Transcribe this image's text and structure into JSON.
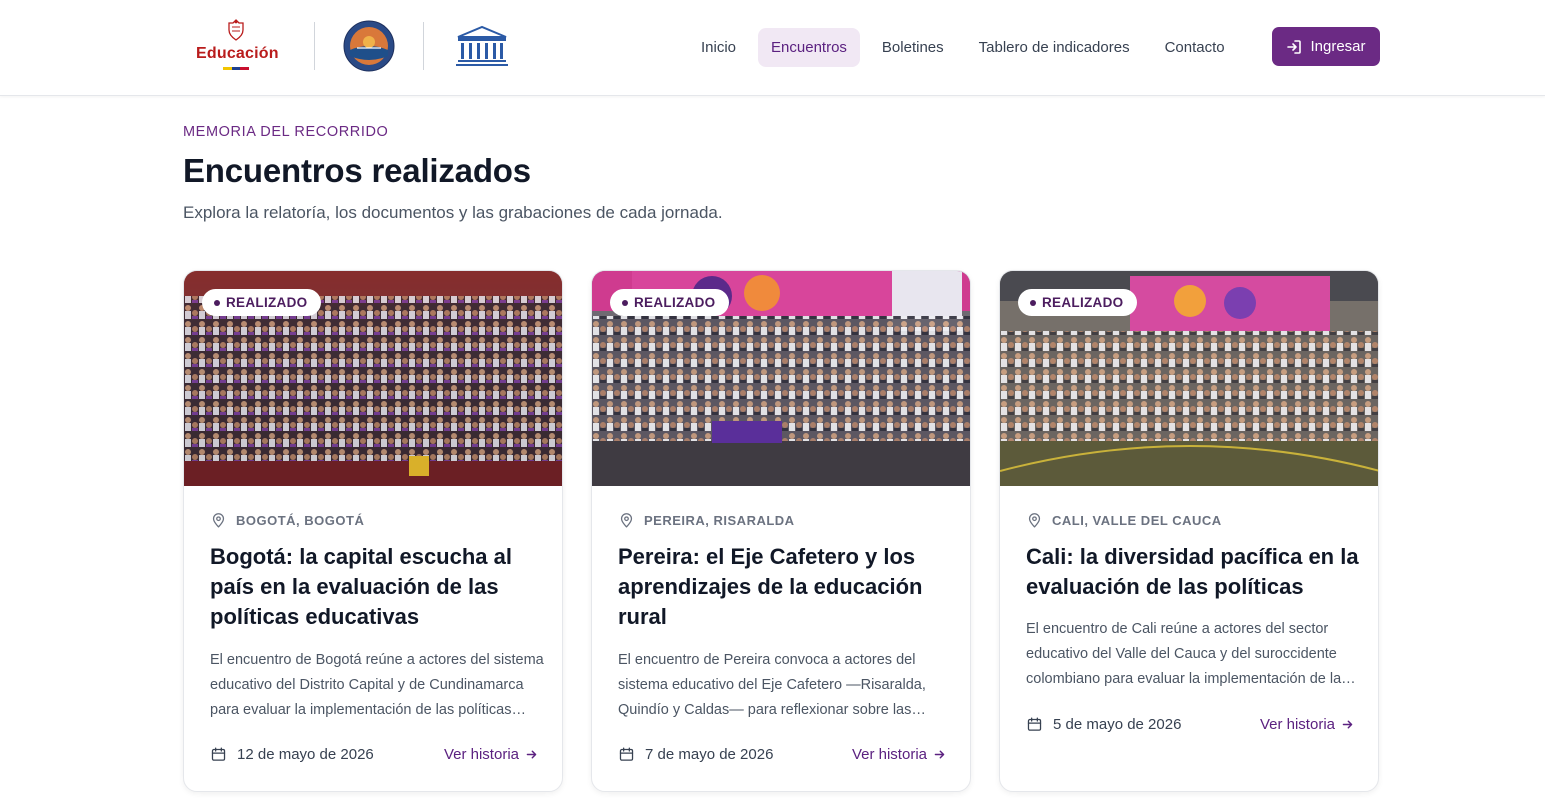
{
  "header": {
    "logo_education_text": "Educación",
    "nav": [
      {
        "label": "Inicio",
        "active": false
      },
      {
        "label": "Encuentros",
        "active": true
      },
      {
        "label": "Boletines",
        "active": false
      },
      {
        "label": "Tablero de indicadores",
        "active": false
      },
      {
        "label": "Contacto",
        "active": false
      }
    ],
    "login_label": "Ingresar"
  },
  "section": {
    "eyebrow": "MEMORIA DEL RECORRIDO",
    "title": "Encuentros realizados",
    "subtitle": "Explora la relatoría, los documentos y las grabaciones de cada jornada."
  },
  "cards": [
    {
      "badge": "REALIZADO",
      "location": "BOGOTÁ, BOGOTÁ",
      "title": "Bogotá: la capital escucha al país en la evaluación de las políticas educativas",
      "description": "El encuentro de Bogotá reúne a actores del sistema educativo del Distrito Capital y de Cundinamarca para evaluar la implementación de las políticas educativas.",
      "date": "12 de mayo de 2026",
      "link": "Ver historia"
    },
    {
      "badge": "REALIZADO",
      "location": "PEREIRA, RISARALDA",
      "title": "Pereira: el Eje Cafetero y los aprendizajes de la educación rural",
      "description": "El encuentro de Pereira convoca a actores del sistema educativo del Eje Cafetero —Risaralda, Quindío y Caldas— para reflexionar sobre las políticas educativas.",
      "date": "7 de mayo de 2026",
      "link": "Ver historia"
    },
    {
      "badge": "REALIZADO",
      "location": "CALI, VALLE DEL CAUCA",
      "title": "Cali: la diversidad pacífica en la evaluación de las políticas",
      "description": "El encuentro de Cali reúne a actores del sector educativo del Valle del Cauca y del suroccidente colombiano para evaluar la implementación de las políticas educativas.",
      "date": "5 de mayo de 2026",
      "link": "Ver historia"
    }
  ],
  "colors": {
    "brand_purple": "#6b2a84",
    "nav_active_bg": "#f1e8f4",
    "education_red": "#b91c1c"
  }
}
